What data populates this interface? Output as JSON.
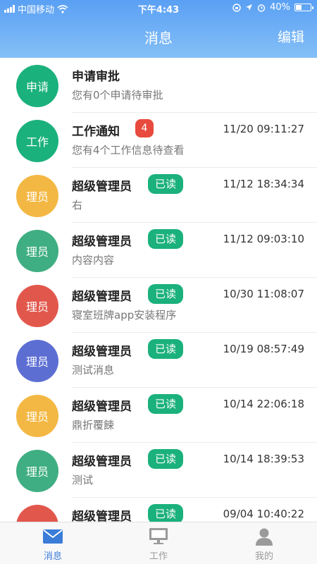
{
  "status_bar": {
    "carrier": "中国移动",
    "time": "下午4:43",
    "battery_text": "40%",
    "battery_level": 0.4
  },
  "nav": {
    "title": "消息",
    "action": "编辑"
  },
  "colors": {
    "green": "#1bb17c",
    "yellow": "#f3b843",
    "sea_green": "#3fae82",
    "red": "#e2574c",
    "blue": "#5d6ed3",
    "badge_red": "#e84a3d",
    "tab_active": "#3a7cd8",
    "tab_inactive": "#9a9a9a"
  },
  "messages": [
    {
      "avatar": "申请",
      "color": "green",
      "title": "申请审批",
      "subtitle": "您有0个申请待审批",
      "badge": "",
      "badge_type": "",
      "time": ""
    },
    {
      "avatar": "工作",
      "color": "green",
      "title": "工作通知",
      "subtitle": "您有4个工作信息待查看",
      "badge": "4",
      "badge_type": "count",
      "time": "11/20 09:11:27"
    },
    {
      "avatar": "理员",
      "color": "yellow",
      "title": "超级管理员",
      "subtitle": "右",
      "badge": "已读",
      "badge_type": "read",
      "time": "11/12 18:34:34"
    },
    {
      "avatar": "理员",
      "color": "sea_green",
      "title": "超级管理员",
      "subtitle": "内容内容",
      "badge": "已读",
      "badge_type": "read",
      "time": "11/12 09:03:10"
    },
    {
      "avatar": "理员",
      "color": "red",
      "title": "超级管理员",
      "subtitle": "寝室班牌app安装程序",
      "badge": "已读",
      "badge_type": "read",
      "time": "10/30 11:08:07"
    },
    {
      "avatar": "理员",
      "color": "blue",
      "title": "超级管理员",
      "subtitle": "测试消息",
      "badge": "已读",
      "badge_type": "read",
      "time": "10/19 08:57:49"
    },
    {
      "avatar": "理员",
      "color": "yellow",
      "title": "超级管理员",
      "subtitle": "鼎折覆餗",
      "badge": "已读",
      "badge_type": "read",
      "time": "10/14 22:06:18"
    },
    {
      "avatar": "理员",
      "color": "sea_green",
      "title": "超级管理员",
      "subtitle": "测试",
      "badge": "已读",
      "badge_type": "read",
      "time": "10/14 18:39:53"
    },
    {
      "avatar": "理员",
      "color": "red",
      "title": "超级管理员",
      "subtitle": "",
      "badge": "已读",
      "badge_type": "read",
      "time": "09/04 10:40:22"
    }
  ],
  "tabs": [
    {
      "label": "消息",
      "icon": "mail-icon",
      "active": true
    },
    {
      "label": "工作",
      "icon": "monitor-icon",
      "active": false
    },
    {
      "label": "我的",
      "icon": "person-icon",
      "active": false
    }
  ]
}
